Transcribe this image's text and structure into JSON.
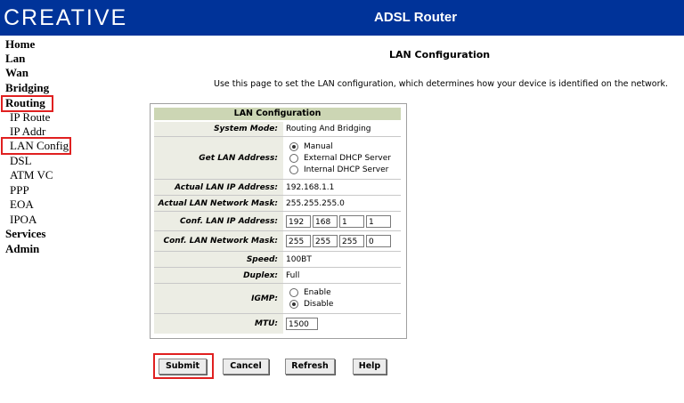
{
  "header": {
    "logo": "CREATIVE",
    "title": "ADSL Router"
  },
  "nav": {
    "home": "Home",
    "lan": "Lan",
    "wan": "Wan",
    "bridging": "Bridging",
    "routing": "Routing",
    "ip_route": "IP Route",
    "ip_addr": "IP Addr",
    "lan_config": "LAN Config",
    "dsl": "DSL",
    "atm_vc": "ATM VC",
    "ppp": "PPP",
    "eoa": "EOA",
    "ipoa": "IPOA",
    "services": "Services",
    "admin": "Admin"
  },
  "page": {
    "title": "LAN Configuration",
    "description": "Use this page to set the LAN configuration, which determines how your device is identified on the network."
  },
  "config": {
    "header": "LAN Configuration",
    "system_mode_label": "System Mode:",
    "system_mode_value": "Routing And Bridging",
    "get_lan_label": "Get LAN Address:",
    "get_lan_options": [
      "Manual",
      "External DHCP Server",
      "Internal DHCP Server"
    ],
    "get_lan_selected": "Manual",
    "actual_ip_label": "Actual LAN IP Address:",
    "actual_ip_value": "192.168.1.1",
    "actual_mask_label": "Actual LAN Network Mask:",
    "actual_mask_value": "255.255.255.0",
    "conf_ip_label": "Conf. LAN IP Address:",
    "conf_ip": [
      "192",
      "168",
      "1",
      "1"
    ],
    "conf_mask_label": "Conf. LAN Network Mask:",
    "conf_mask": [
      "255",
      "255",
      "255",
      "0"
    ],
    "speed_label": "Speed:",
    "speed_value": "100BT",
    "duplex_label": "Duplex:",
    "duplex_value": "Full",
    "igmp_label": "IGMP:",
    "igmp_options": [
      "Enable",
      "Disable"
    ],
    "igmp_selected": "Disable",
    "mtu_label": "MTU:",
    "mtu_value": "1500"
  },
  "buttons": {
    "submit": "Submit",
    "cancel": "Cancel",
    "refresh": "Refresh",
    "help": "Help"
  },
  "colors": {
    "header_bg": "#003399",
    "table_header_bg": "#ccd6b4",
    "label_bg": "#ecede4",
    "highlight": "#e02020"
  }
}
